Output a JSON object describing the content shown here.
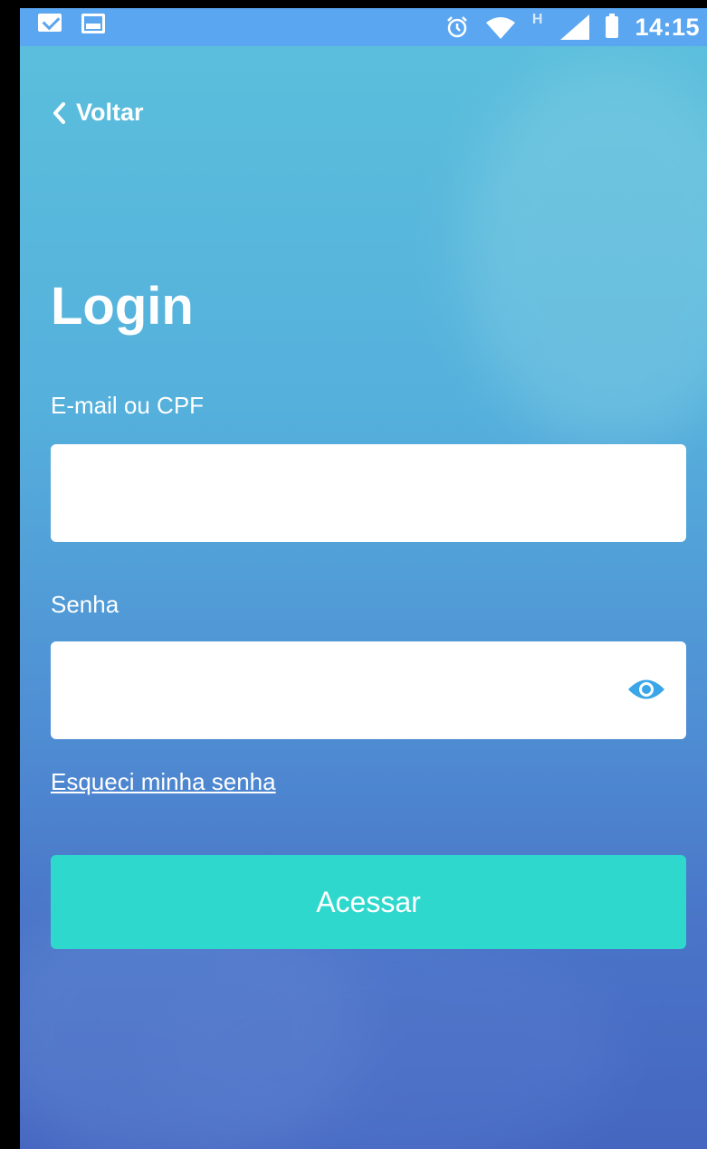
{
  "status_bar": {
    "time": "14:15",
    "network_indicator": "H",
    "left_icons": [
      "gmail-icon",
      "image-icon"
    ],
    "right_icons": [
      "alarm-icon",
      "wifi-icon",
      "signal-icon",
      "battery-icon"
    ]
  },
  "nav": {
    "back_label": "Voltar",
    "back_icon": "chevron-left-icon"
  },
  "page": {
    "title": "Login"
  },
  "form": {
    "email_label": "E-mail ou CPF",
    "email_value": "",
    "email_placeholder": "",
    "password_label": "Senha",
    "password_value": "",
    "password_placeholder": "",
    "password_toggle_icon": "eye-icon",
    "forgot_link": "Esqueci minha senha",
    "submit_label": "Acessar"
  },
  "colors": {
    "status_bar": "#5aa6f0",
    "background_top": "#5cc0dc",
    "background_bottom": "#4566c0",
    "accent_button": "#2fd8cc",
    "eye_icon": "#3aa6e8"
  }
}
